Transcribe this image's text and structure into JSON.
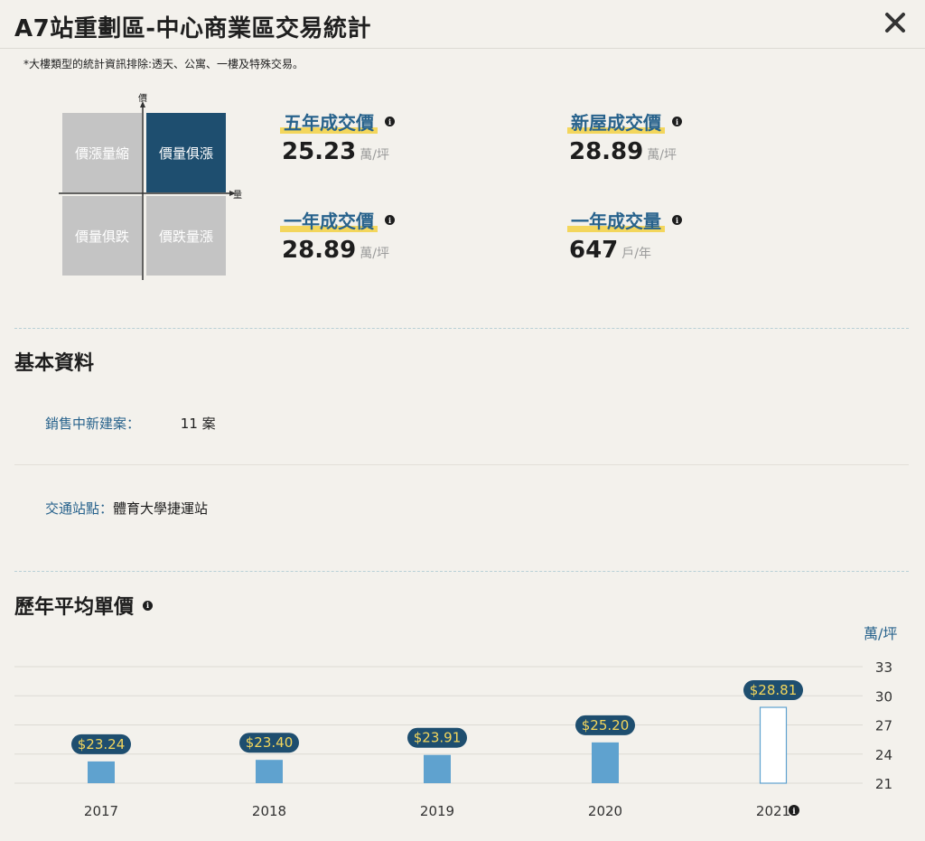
{
  "header": {
    "title": "A7站重劃區-中心商業區交易統計"
  },
  "note": "*大樓類型的統計資訊排除:透天、公寓、一樓及特殊交易。",
  "quadrant": {
    "axis_y": "價",
    "axis_x": "量",
    "cells": {
      "top_left": "價漲量縮",
      "top_right": "價量俱漲",
      "bottom_left": "價量俱跌",
      "bottom_right": "價跌量漲"
    },
    "active": "top_right"
  },
  "stats": {
    "five_year_price": {
      "label": "五年成交價",
      "value": "25.23",
      "unit": "萬/坪"
    },
    "new_house_price": {
      "label": "新屋成交價",
      "value": "28.89",
      "unit": "萬/坪"
    },
    "one_year_price": {
      "label": "一年成交價",
      "value": "28.89",
      "unit": "萬/坪"
    },
    "one_year_volume": {
      "label": "一年成交量",
      "value": "647",
      "unit": "戶/年"
    }
  },
  "basic_info": {
    "title": "基本資料",
    "projects_key": "銷售中新建案：",
    "projects_value": "11 案",
    "transit_key": "交通站點：",
    "transit_value": "體育大學捷運站"
  },
  "chart_section": {
    "title": "歷年平均單價",
    "unit": "萬/坪"
  },
  "chart_data": {
    "type": "bar",
    "categories": [
      "2017",
      "2018",
      "2019",
      "2020",
      "2021"
    ],
    "values": [
      23.24,
      23.4,
      23.91,
      25.2,
      28.81
    ],
    "data_labels": [
      "$23.24",
      "$23.40",
      "$23.91",
      "$25.20",
      "$28.81"
    ],
    "yticks": [
      "33",
      "30",
      "27",
      "24",
      "21"
    ],
    "ylim": [
      21,
      33
    ],
    "colors": {
      "bar": "#5fa2cf",
      "bar_outline": "#5fa2cf",
      "label_bg": "#1e4e6f",
      "label_text": "#f3d65c"
    },
    "hollow_last": true
  }
}
